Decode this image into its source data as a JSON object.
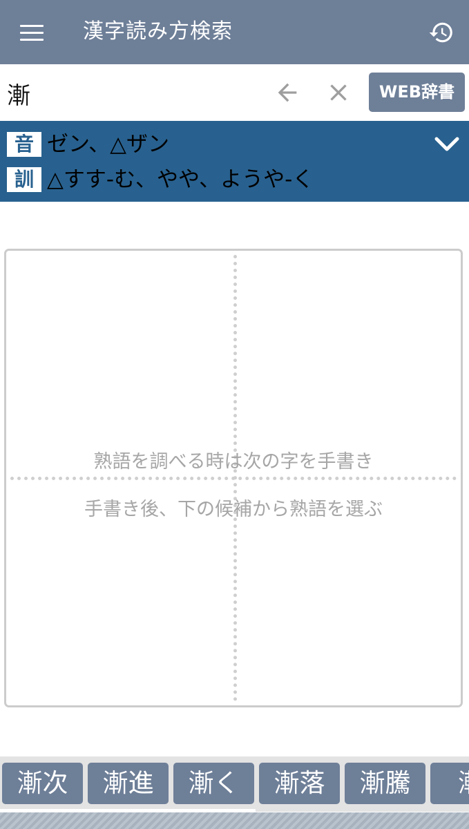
{
  "app_bar": {
    "title": "漢字読み方検索",
    "menu_icon": "hamburger-menu-icon",
    "history_icon": "history-icon"
  },
  "search": {
    "value": "漸",
    "back_icon": "arrow-left-icon",
    "clear_icon": "close-icon",
    "web_dictionary_label": "WEB辞書"
  },
  "readings": {
    "on_badge": "音",
    "on_text": "ゼン、△ザン",
    "kun_badge": "訓",
    "kun_text": "△すす-む、やや、ようや-く",
    "expand_icon": "chevron-down-icon"
  },
  "handwriting": {
    "hint_line1": "熟語を調べる時は次の字を手書き",
    "hint_line2": "手書き後、下の候補から熟語を選ぶ"
  },
  "candidates": [
    "漸次",
    "漸進",
    "漸く",
    "漸落",
    "漸騰",
    "漸"
  ],
  "colors": {
    "app_bar": "#6e7f98",
    "readings_panel": "#28618f",
    "candidate_button": "#6e7f98",
    "hint_text": "#a6a6a6"
  }
}
